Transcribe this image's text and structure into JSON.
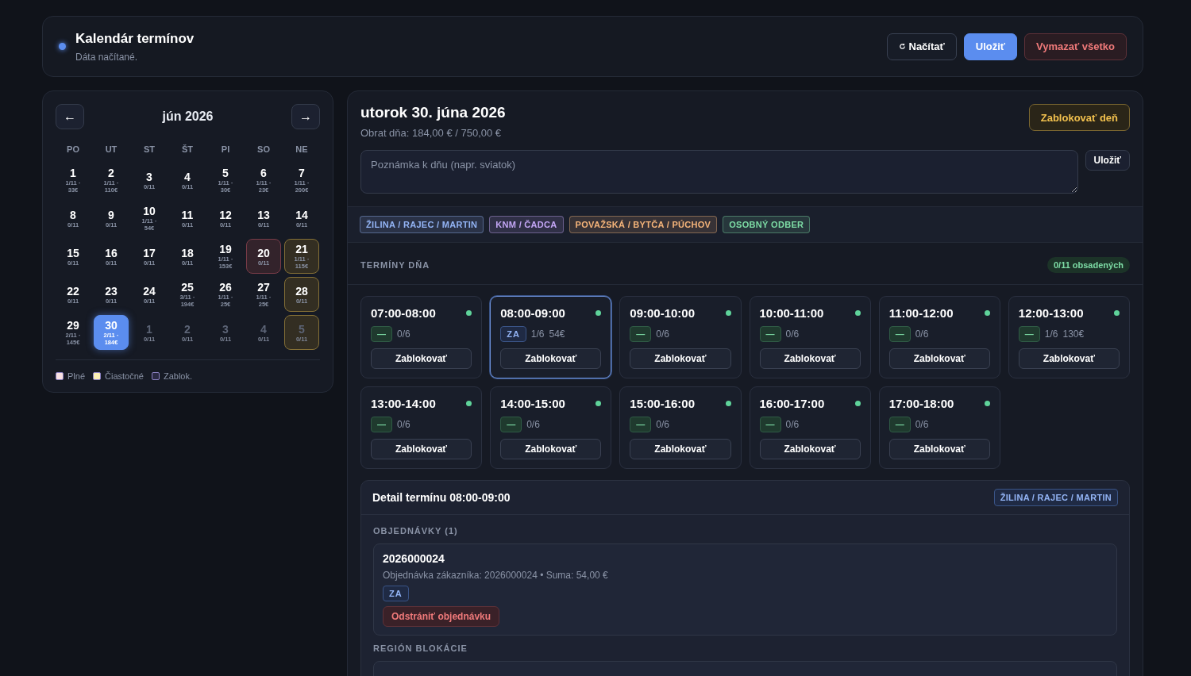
{
  "header": {
    "title": "Kalendár termínov",
    "subtitle": "Dáta načítané.",
    "buttons": [
      {
        "label": "Načítať",
        "kind": "reload"
      },
      {
        "label": "Uložiť",
        "kind": "primary"
      },
      {
        "label": "Vymazať všetko",
        "kind": "danger"
      }
    ]
  },
  "calendar": {
    "month": "jún 2026",
    "prev": "←",
    "next": "→",
    "weekdays": [
      "PO",
      "UT",
      "ST",
      "ŠT",
      "PI",
      "SO",
      "NE"
    ],
    "days": [
      {
        "day": "1",
        "info": "1/11 · 33€",
        "full": false,
        "partial": false,
        "selected": false,
        "outside": false
      },
      {
        "day": "2",
        "info": "1/11 · 110€",
        "full": false,
        "partial": false,
        "selected": false,
        "outside": false
      },
      {
        "day": "3",
        "info": "0/11",
        "full": false,
        "partial": false,
        "selected": false,
        "outside": false
      },
      {
        "day": "4",
        "info": "0/11",
        "full": false,
        "partial": false,
        "selected": false,
        "outside": false
      },
      {
        "day": "5",
        "info": "1/11 · 30€",
        "full": false,
        "partial": false,
        "selected": false,
        "outside": false
      },
      {
        "day": "6",
        "info": "1/11 · 23€",
        "full": false,
        "partial": false,
        "selected": false,
        "outside": false
      },
      {
        "day": "7",
        "info": "1/11 · 200€",
        "full": false,
        "partial": false,
        "selected": false,
        "outside": false
      },
      {
        "day": "8",
        "info": "0/11",
        "full": false,
        "partial": false,
        "selected": false,
        "outside": false
      },
      {
        "day": "9",
        "info": "0/11",
        "full": false,
        "partial": false,
        "selected": false,
        "outside": false
      },
      {
        "day": "10",
        "info": "1/11 · 54€",
        "full": false,
        "partial": false,
        "selected": false,
        "outside": false
      },
      {
        "day": "11",
        "info": "0/11",
        "full": false,
        "partial": false,
        "selected": false,
        "outside": false
      },
      {
        "day": "12",
        "info": "0/11",
        "full": false,
        "partial": false,
        "selected": false,
        "outside": false
      },
      {
        "day": "13",
        "info": "0/11",
        "full": false,
        "partial": false,
        "selected": false,
        "outside": false
      },
      {
        "day": "14",
        "info": "0/11",
        "full": false,
        "partial": false,
        "selected": false,
        "outside": false
      },
      {
        "day": "15",
        "info": "0/11",
        "full": false,
        "partial": false,
        "selected": false,
        "outside": false
      },
      {
        "day": "16",
        "info": "0/11",
        "full": false,
        "partial": false,
        "selected": false,
        "outside": false
      },
      {
        "day": "17",
        "info": "0/11",
        "full": false,
        "partial": false,
        "selected": false,
        "outside": false
      },
      {
        "day": "18",
        "info": "0/11",
        "full": false,
        "partial": false,
        "selected": false,
        "outside": false
      },
      {
        "day": "19",
        "info": "1/11 · 153€",
        "full": false,
        "partial": false,
        "selected": false,
        "outside": false
      },
      {
        "day": "20",
        "info": "0/11",
        "full": true,
        "partial": false,
        "selected": false,
        "outside": false
      },
      {
        "day": "21",
        "info": "1/11 · 115€",
        "full": false,
        "partial": true,
        "selected": false,
        "outside": false
      },
      {
        "day": "22",
        "info": "0/11",
        "full": false,
        "partial": false,
        "selected": false,
        "outside": false
      },
      {
        "day": "23",
        "info": "0/11",
        "full": false,
        "partial": false,
        "selected": false,
        "outside": false
      },
      {
        "day": "24",
        "info": "0/11",
        "full": false,
        "partial": false,
        "selected": false,
        "outside": false
      },
      {
        "day": "25",
        "info": "3/11 · 194€",
        "full": false,
        "partial": false,
        "selected": false,
        "outside": false
      },
      {
        "day": "26",
        "info": "1/11 · 25€",
        "full": false,
        "partial": false,
        "selected": false,
        "outside": false
      },
      {
        "day": "27",
        "info": "1/11 · 25€",
        "full": false,
        "partial": false,
        "selected": false,
        "outside": false
      },
      {
        "day": "28",
        "info": "0/11",
        "full": false,
        "partial": true,
        "selected": false,
        "outside": false
      },
      {
        "day": "29",
        "info": "2/11 · 145€",
        "full": false,
        "partial": false,
        "selected": false,
        "outside": false
      },
      {
        "day": "30",
        "info": "2/11 · 184€",
        "full": false,
        "partial": false,
        "selected": true,
        "outside": false
      },
      {
        "day": "1",
        "info": "0/11",
        "full": false,
        "partial": false,
        "selected": false,
        "outside": true
      },
      {
        "day": "2",
        "info": "0/11",
        "full": false,
        "partial": false,
        "selected": false,
        "outside": true
      },
      {
        "day": "3",
        "info": "0/11",
        "full": false,
        "partial": false,
        "selected": false,
        "outside": true
      },
      {
        "day": "4",
        "info": "0/11",
        "full": false,
        "partial": false,
        "selected": false,
        "outside": true
      },
      {
        "day": "5",
        "info": "0/11",
        "full": false,
        "partial": true,
        "selected": false,
        "outside": true
      }
    ],
    "legend": [
      {
        "label": "Plné",
        "color": "#f9e1e3"
      },
      {
        "label": "Čiastočné",
        "color": "#fbefb4"
      },
      {
        "label": "Zablok.",
        "color": "#2b2a44"
      }
    ]
  },
  "day": {
    "title": "utorok 30. júna 2026",
    "turnover": "Obrat dňa: 184,00 € / 750,00 €",
    "block_button": "Zablokovať deň",
    "note": {
      "placeholder": "Poznámka k dňu (napr. sviatok)",
      "save": "Uložiť"
    },
    "regions": [
      {
        "label": "ŽILINA / RAJEC / MARTIN",
        "color": "#93b4f5"
      },
      {
        "label": "KNM / ČADCA",
        "color": "#c3a6f5"
      },
      {
        "label": "POVAŽSKÁ / BYTČA / PÚCHOV",
        "color": "#f5b47a"
      },
      {
        "label": "OSOBNÝ ODBER",
        "color": "#7ddca5"
      }
    ],
    "slots_label": "TERMÍNY DŇA",
    "occupancy": "0/11 obsadených",
    "slots": [
      {
        "time": "07:00-08:00",
        "available": true,
        "chip": "—",
        "assigned": false,
        "count": "0/6",
        "selected": false,
        "button": "Zablokovať"
      },
      {
        "time": "08:00-09:00",
        "available": true,
        "chip": "ZA",
        "assigned": true,
        "count": "1/6",
        "amount": "54€",
        "selected": true,
        "button": "Zablokovať"
      },
      {
        "time": "09:00-10:00",
        "available": true,
        "chip": "—",
        "assigned": false,
        "count": "0/6",
        "selected": false,
        "button": "Zablokovať"
      },
      {
        "time": "10:00-11:00",
        "available": true,
        "chip": "—",
        "assigned": false,
        "count": "0/6",
        "selected": false,
        "button": "Zablokovať"
      },
      {
        "time": "11:00-12:00",
        "available": true,
        "chip": "—",
        "assigned": false,
        "count": "0/6",
        "selected": false,
        "button": "Zablokovať"
      },
      {
        "time": "12:00-13:00",
        "available": true,
        "chip": "—",
        "assigned": false,
        "count": "1/6",
        "amount": "130€",
        "selected": false,
        "button": "Zablokovať"
      },
      {
        "time": "13:00-14:00",
        "available": true,
        "chip": "—",
        "assigned": false,
        "count": "0/6",
        "selected": false,
        "button": "Zablokovať"
      },
      {
        "time": "14:00-15:00",
        "available": true,
        "chip": "—",
        "assigned": false,
        "count": "0/6",
        "selected": false,
        "button": "Zablokovať"
      },
      {
        "time": "15:00-16:00",
        "available": true,
        "chip": "—",
        "assigned": false,
        "count": "0/6",
        "selected": false,
        "button": "Zablokovať"
      },
      {
        "time": "16:00-17:00",
        "available": true,
        "chip": "—",
        "assigned": false,
        "count": "0/6",
        "selected": false,
        "button": "Zablokovať"
      },
      {
        "time": "17:00-18:00",
        "available": true,
        "chip": "—",
        "assigned": false,
        "count": "0/6",
        "selected": false,
        "button": "Zablokovať"
      }
    ],
    "detail": {
      "title": "Detail termínu 08:00-09:00",
      "region": "ŽILINA / RAJEC / MARTIN",
      "orders_label": "OBJEDNÁVKY (1)",
      "orders": [
        {
          "number": "2026000024",
          "description": "Objednávka zákazníka: 2026000024 • Suma: 54,00 €",
          "tag": "ZA",
          "remove": "Odstrániť objednávku"
        }
      ],
      "block_label": "REGIÓN BLOKÁCIE"
    }
  }
}
